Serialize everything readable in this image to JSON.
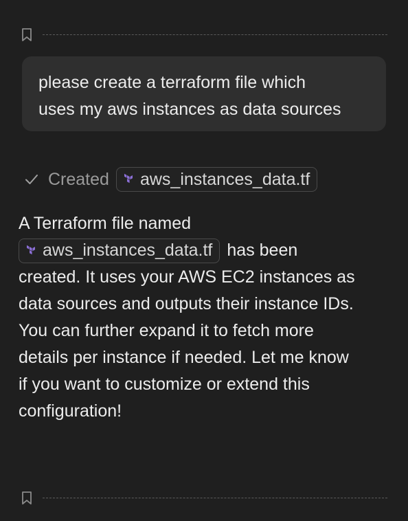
{
  "user_message": {
    "line1": "please create a terraform file which",
    "line2": "uses my aws instances as data sources"
  },
  "tool_status": {
    "label": "Created",
    "file_name": "aws_instances_data.tf"
  },
  "assistant_reply": {
    "line1": "A Terraform file named",
    "file_name": "aws_instances_data.tf",
    "line2_after_chip": "has been",
    "line3": "created. It uses your AWS EC2 instances as",
    "line4": "data sources and outputs their instance IDs.",
    "line5": "You can further expand it to fetch more",
    "line6": "details per instance if needed. Let me know",
    "line7": "if you want to customize or extend this",
    "line8": "configuration!"
  },
  "icons": {
    "bookmark": "bookmark-icon",
    "check": "check-icon",
    "terraform": "terraform-icon"
  },
  "colors": {
    "background": "#1f1f1f",
    "bubble": "#2f2f2f",
    "terraform_purple": "#8b6fd6",
    "muted_text": "#9a9a9a"
  }
}
